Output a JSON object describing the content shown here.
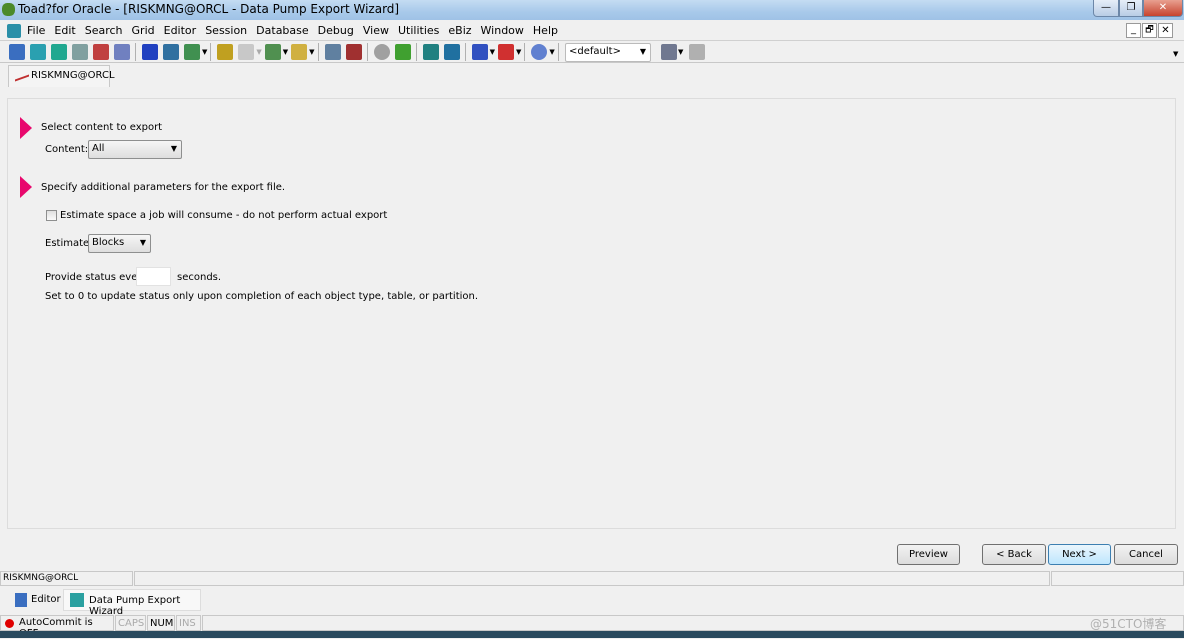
{
  "window": {
    "title": "Toad?for Oracle - [RISKMNG@ORCL - Data Pump Export Wizard]",
    "minimize": "—",
    "maximize": "❐",
    "close": "✕"
  },
  "mdi": {
    "minimize": "_",
    "restore": "🗗",
    "close": "✕"
  },
  "menu": [
    "File",
    "Edit",
    "Search",
    "Grid",
    "Editor",
    "Session",
    "Database",
    "Debug",
    "View",
    "Utilities",
    "eBiz",
    "Window",
    "Help"
  ],
  "toolbar": {
    "schema_dropdown": "<default>"
  },
  "connection_tab": "RISKMNG@ORCL",
  "wizard": {
    "step1_heading": "Select content to export",
    "content_label": "Content:",
    "content_value": "All",
    "step2_heading": "Specify additional parameters for the export file.",
    "estimate_checkbox_label": "Estimate space a job will consume - do not perform actual export",
    "estimate_checked": false,
    "estimate_label": "Estimate:",
    "estimate_value": "Blocks",
    "status_label": "Provide status every",
    "status_value": "",
    "status_unit": "seconds.",
    "status_hint": "Set to 0 to update status only upon completion of each object type, table, or partition."
  },
  "buttons": {
    "preview": "Preview",
    "back": "< Back",
    "next": "Next >",
    "cancel": "Cancel"
  },
  "status_connection": "RISKMNG@ORCL",
  "window_tabs": [
    "Editor",
    "Data Pump Export Wizard"
  ],
  "statusbar": {
    "autocommit": "AutoCommit is OFF",
    "caps": "CAPS",
    "num": "NUM",
    "ins": "INS"
  },
  "watermark": "@51CTO博客",
  "colors": {
    "accent_arrow": "#e8086d"
  }
}
